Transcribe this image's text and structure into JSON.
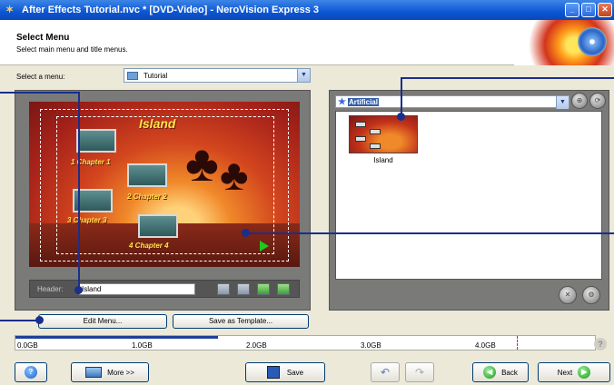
{
  "window": {
    "title": "After Effects Tutorial.nvc * [DVD-Video] - NeroVision Express 3",
    "app_icon": "nero-icon",
    "controls": [
      "minimize",
      "maximize",
      "close"
    ]
  },
  "header": {
    "title": "Select Menu",
    "subtitle": "Select main menu and title menus."
  },
  "menu_select": {
    "label": "Select a menu:",
    "value": "Tutorial"
  },
  "preview": {
    "menu_title": "Island",
    "chapters": [
      "1 Chapter 1",
      "2 Chapter 2",
      "3 Chapter 3",
      "4 Chapter 4"
    ],
    "header_label": "Header:",
    "header_value": "Island"
  },
  "buttons": {
    "edit_menu": "Edit Menu...",
    "save_template": "Save as Template..."
  },
  "templates": {
    "category": "Artificial",
    "items": [
      {
        "label": "Island"
      }
    ]
  },
  "capacity": {
    "ticks": [
      "0.0GB",
      "1.0GB",
      "2.0GB",
      "3.0GB",
      "4.0GB"
    ],
    "used_fraction": 0.35
  },
  "bottom": {
    "more": "More >>",
    "save": "Save",
    "back": "Back",
    "next": "Next"
  },
  "colors": {
    "accent": "#1a2e8c",
    "title_bar": "#0c56d4"
  }
}
